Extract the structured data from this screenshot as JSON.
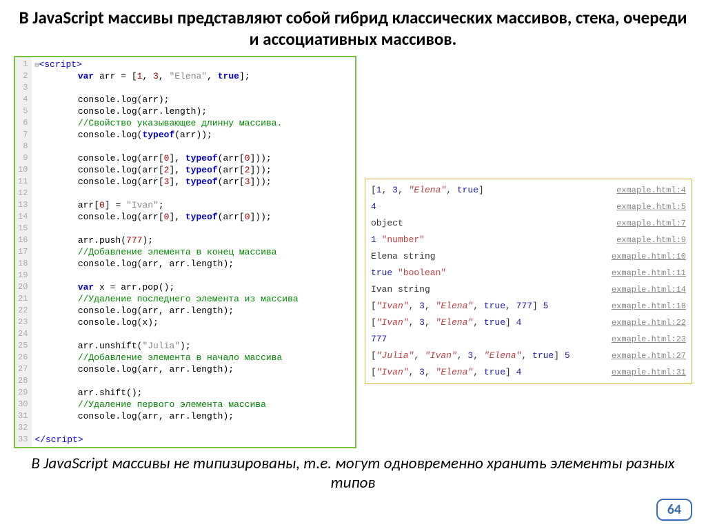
{
  "title": "В JavaScript массивы представляют собой гибрид классических массивов, стека, очереди и ассоциативных массивов.",
  "footer": "В JavaScript массивы не типизированы, т.е. могут одновременно хранить элементы разных типов",
  "page_number": "64",
  "code": {
    "lines": [
      {
        "n": "1",
        "html": "<span class='fold'>⊟</span><span class='tag'>&lt;script&gt;</span>"
      },
      {
        "n": "2",
        "html": "        <span class='kw'>var</span> arr = [<span class='num'>1</span>, <span class='num'>3</span>, <span class='str'>\"Elena\"</span>, <span class='bool'>true</span>];"
      },
      {
        "n": "3",
        "html": ""
      },
      {
        "n": "4",
        "html": "        console.log(arr);"
      },
      {
        "n": "5",
        "html": "        console.log(arr.length);"
      },
      {
        "n": "6",
        "html": "        <span class='com'>//Свойство указывающее длинну массива.</span>"
      },
      {
        "n": "7",
        "html": "        console.log(<span class='kw'>typeof</span>(arr));"
      },
      {
        "n": "8",
        "html": ""
      },
      {
        "n": "9",
        "html": "        console.log(arr[<span class='num'>0</span>], <span class='kw'>typeof</span>(arr[<span class='num'>0</span>]));"
      },
      {
        "n": "10",
        "html": "        console.log(arr[<span class='num'>2</span>], <span class='kw'>typeof</span>(arr[<span class='num'>2</span>]));"
      },
      {
        "n": "11",
        "html": "        console.log(arr[<span class='num'>3</span>], <span class='kw'>typeof</span>(arr[<span class='num'>3</span>]));"
      },
      {
        "n": "12",
        "html": ""
      },
      {
        "n": "13",
        "html": "        arr[<span class='num'>0</span>] = <span class='str'>\"Ivan\"</span>;"
      },
      {
        "n": "14",
        "html": "        console.log(arr[<span class='num'>0</span>], <span class='kw'>typeof</span>(arr[<span class='num'>0</span>]));"
      },
      {
        "n": "15",
        "html": ""
      },
      {
        "n": "16",
        "html": "        arr.push(<span class='num'>777</span>);"
      },
      {
        "n": "17",
        "html": "        <span class='com'>//Добавление элемента в конец массива</span>"
      },
      {
        "n": "18",
        "html": "        console.log(arr, arr.length);"
      },
      {
        "n": "19",
        "html": ""
      },
      {
        "n": "20",
        "html": "        <span class='kw'>var</span> x = arr.pop();"
      },
      {
        "n": "21",
        "html": "        <span class='com'>//Удаление последнего элемента из массива</span>"
      },
      {
        "n": "22",
        "html": "        console.log(arr, arr.length);"
      },
      {
        "n": "23",
        "html": "        console.log(x);"
      },
      {
        "n": "24",
        "html": ""
      },
      {
        "n": "25",
        "html": "        arr.unshift(<span class='str'>\"Julia\"</span>);"
      },
      {
        "n": "26",
        "html": "        <span class='com'>//Добавление элемента в начало массива</span>"
      },
      {
        "n": "27",
        "html": "        console.log(arr, arr.length);"
      },
      {
        "n": "28",
        "html": ""
      },
      {
        "n": "29",
        "html": "        arr.shift();"
      },
      {
        "n": "30",
        "html": "        <span class='com'>//Удаление первого элемента массива</span>"
      },
      {
        "n": "31",
        "html": "        console.log(arr, arr.length);"
      },
      {
        "n": "32",
        "html": ""
      },
      {
        "n": "33",
        "html": "<span class='tag'>&lt;/script&gt;</span>"
      }
    ]
  },
  "console": [
    {
      "left": "[<span class='cnum'>1</span>, <span class='cnum'>3</span>, <span class='cstr cit'>\"Elena\"</span>, <span class='cbool'>true</span>]",
      "right": "exmaple.html:4"
    },
    {
      "left": "<span class='cnum'>4</span>",
      "right": "exmaple.html:5"
    },
    {
      "left": "object",
      "right": "exmaple.html:7"
    },
    {
      "left": "<span class='cnum'>1</span> <span class='cstr'>\"number\"</span>",
      "right": "exmaple.html:9"
    },
    {
      "left": "Elena string",
      "right": "exmaple.html:10"
    },
    {
      "left": "<span class='cbool'>true</span> <span class='cstr'>\"boolean\"</span>",
      "right": "exmaple.html:11"
    },
    {
      "left": "Ivan string",
      "right": "exmaple.html:14"
    },
    {
      "left": "[<span class='cstr cit'>\"Ivan\"</span>, <span class='cnum'>3</span>, <span class='cstr cit'>\"Elena\"</span>, <span class='cbool'>true</span>, <span class='cnum'>777</span>] <span class='cnum'>5</span>",
      "right": "exmaple.html:18"
    },
    {
      "left": "[<span class='cstr cit'>\"Ivan\"</span>, <span class='cnum'>3</span>, <span class='cstr cit'>\"Elena\"</span>, <span class='cbool'>true</span>] <span class='cnum'>4</span>",
      "right": "exmaple.html:22"
    },
    {
      "left": "<span class='cnum'>777</span>",
      "right": "exmaple.html:23"
    },
    {
      "left": "[<span class='cstr cit'>\"Julia\"</span>, <span class='cstr cit'>\"Ivan\"</span>, <span class='cnum'>3</span>, <span class='cstr cit'>\"Elena\"</span>, <span class='cbool'>true</span>] <span class='cnum'>5</span>",
      "right": "exmaple.html:27"
    },
    {
      "left": "[<span class='cstr cit'>\"Ivan\"</span>, <span class='cnum'>3</span>, <span class='cstr cit'>\"Elena\"</span>, <span class='cbool'>true</span>] <span class='cnum'>4</span>",
      "right": "exmaple.html:31"
    }
  ]
}
